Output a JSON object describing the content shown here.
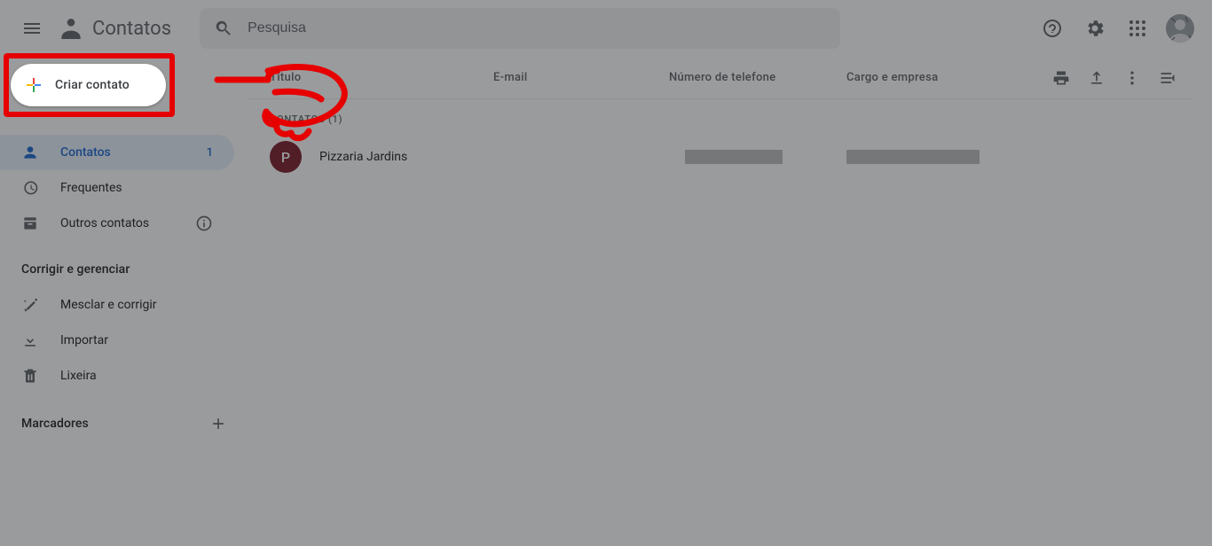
{
  "header": {
    "app_title": "Contatos",
    "search_placeholder": "Pesquisa"
  },
  "sidebar": {
    "create_label": "Criar contato",
    "nav": [
      {
        "icon": "person",
        "label": "Contatos",
        "count": "1",
        "active": true
      },
      {
        "icon": "history",
        "label": "Frequentes"
      },
      {
        "icon": "archive",
        "label": "Outros contatos",
        "info": true
      }
    ],
    "manage_title": "Corrigir e gerenciar",
    "manage": [
      {
        "icon": "wand",
        "label": "Mesclar e corrigir"
      },
      {
        "icon": "download",
        "label": "Importar"
      },
      {
        "icon": "trash",
        "label": "Lixeira"
      }
    ],
    "labels_title": "Marcadores"
  },
  "main": {
    "columns": {
      "name": "Título",
      "email": "E-mail",
      "phone": "Número de telefone",
      "job": "Cargo e empresa"
    },
    "section_label": "Contatos (1)",
    "contacts": [
      {
        "initial": "P",
        "name": "Pizzaria Jardins",
        "phone_redacted": true,
        "job_redacted": true
      }
    ]
  }
}
